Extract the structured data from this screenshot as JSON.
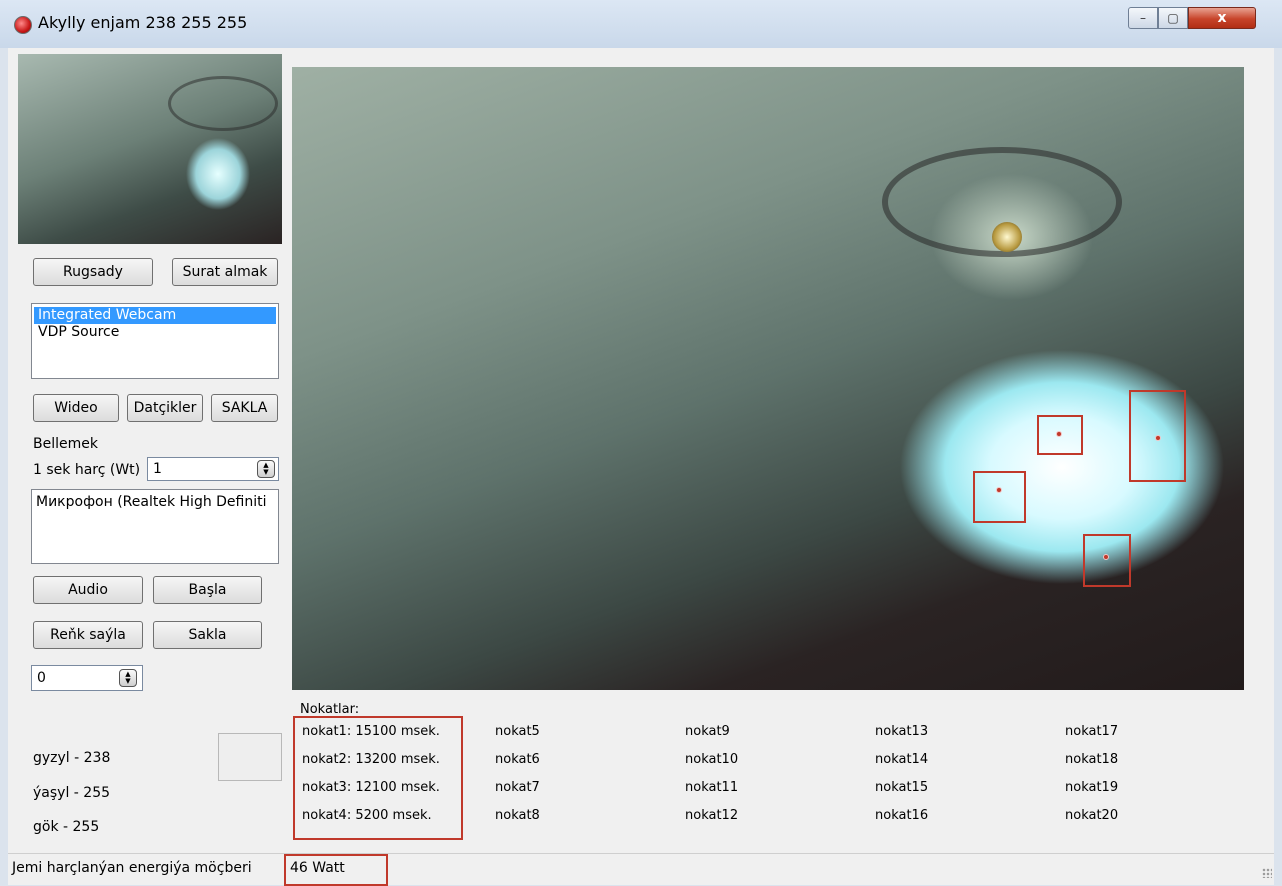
{
  "window": {
    "title": "Akylly enjam 238 255 255",
    "close_glyph": "x",
    "min_glyph": "–",
    "max_glyph": "▢"
  },
  "left": {
    "btn_rugsady": "Rugsady",
    "btn_surat": "Surat almak",
    "devices": [
      "Integrated Webcam",
      "VDP Source"
    ],
    "btn_wideo": "Wideo",
    "btn_datciler": "Datçikler",
    "btn_sakla1": "SAKLA",
    "label_bellemek": "Bellemek",
    "label_harc": "1 sek harç (Wt)",
    "harc_value": "1",
    "mic_device": "Микрофон (Realtek High Definiti",
    "btn_audio": "Audio",
    "btn_basla": "Başla",
    "btn_renk": "Reňk saýla",
    "btn_sakla2": "Sakla",
    "counter_value": "0",
    "color_red": "gyzyl - 238",
    "color_green": "ýaşyl - 255",
    "color_blue": "gök - 255"
  },
  "points": {
    "header": "Nokatlar:",
    "col1": [
      "nokat1: 15100 msek.",
      "nokat2: 13200 msek.",
      "nokat3: 12100 msek.",
      "nokat4: 5200 msek."
    ],
    "col2": [
      "nokat5",
      "nokat6",
      "nokat7",
      "nokat8"
    ],
    "col3": [
      "nokat9",
      "nokat10",
      "nokat11",
      "nokat12"
    ],
    "col4": [
      "nokat13",
      "nokat14",
      "nokat15",
      "nokat16"
    ],
    "col5": [
      "nokat17",
      "nokat18",
      "nokat19",
      "nokat20"
    ]
  },
  "status": {
    "label": "Jemi harçlanýan energiýa möçberi",
    "value": "46 Watt"
  },
  "colors": {
    "accent_red": "#c0392b",
    "selection": "#3399ff"
  }
}
